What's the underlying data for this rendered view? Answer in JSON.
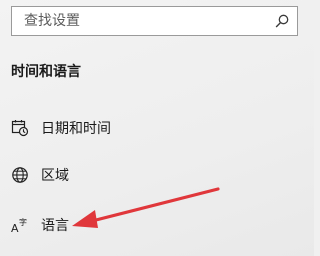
{
  "search": {
    "placeholder": "查找设置",
    "icon": "search-icon"
  },
  "section": {
    "title": "时间和语言"
  },
  "nav": {
    "items": [
      {
        "label": "日期和时间",
        "icon": "calendar-clock-icon"
      },
      {
        "label": "区域",
        "icon": "globe-icon"
      },
      {
        "label": "语言",
        "icon": "language-icon"
      }
    ]
  },
  "annotation": {
    "arrow_color": "#e0373b"
  }
}
